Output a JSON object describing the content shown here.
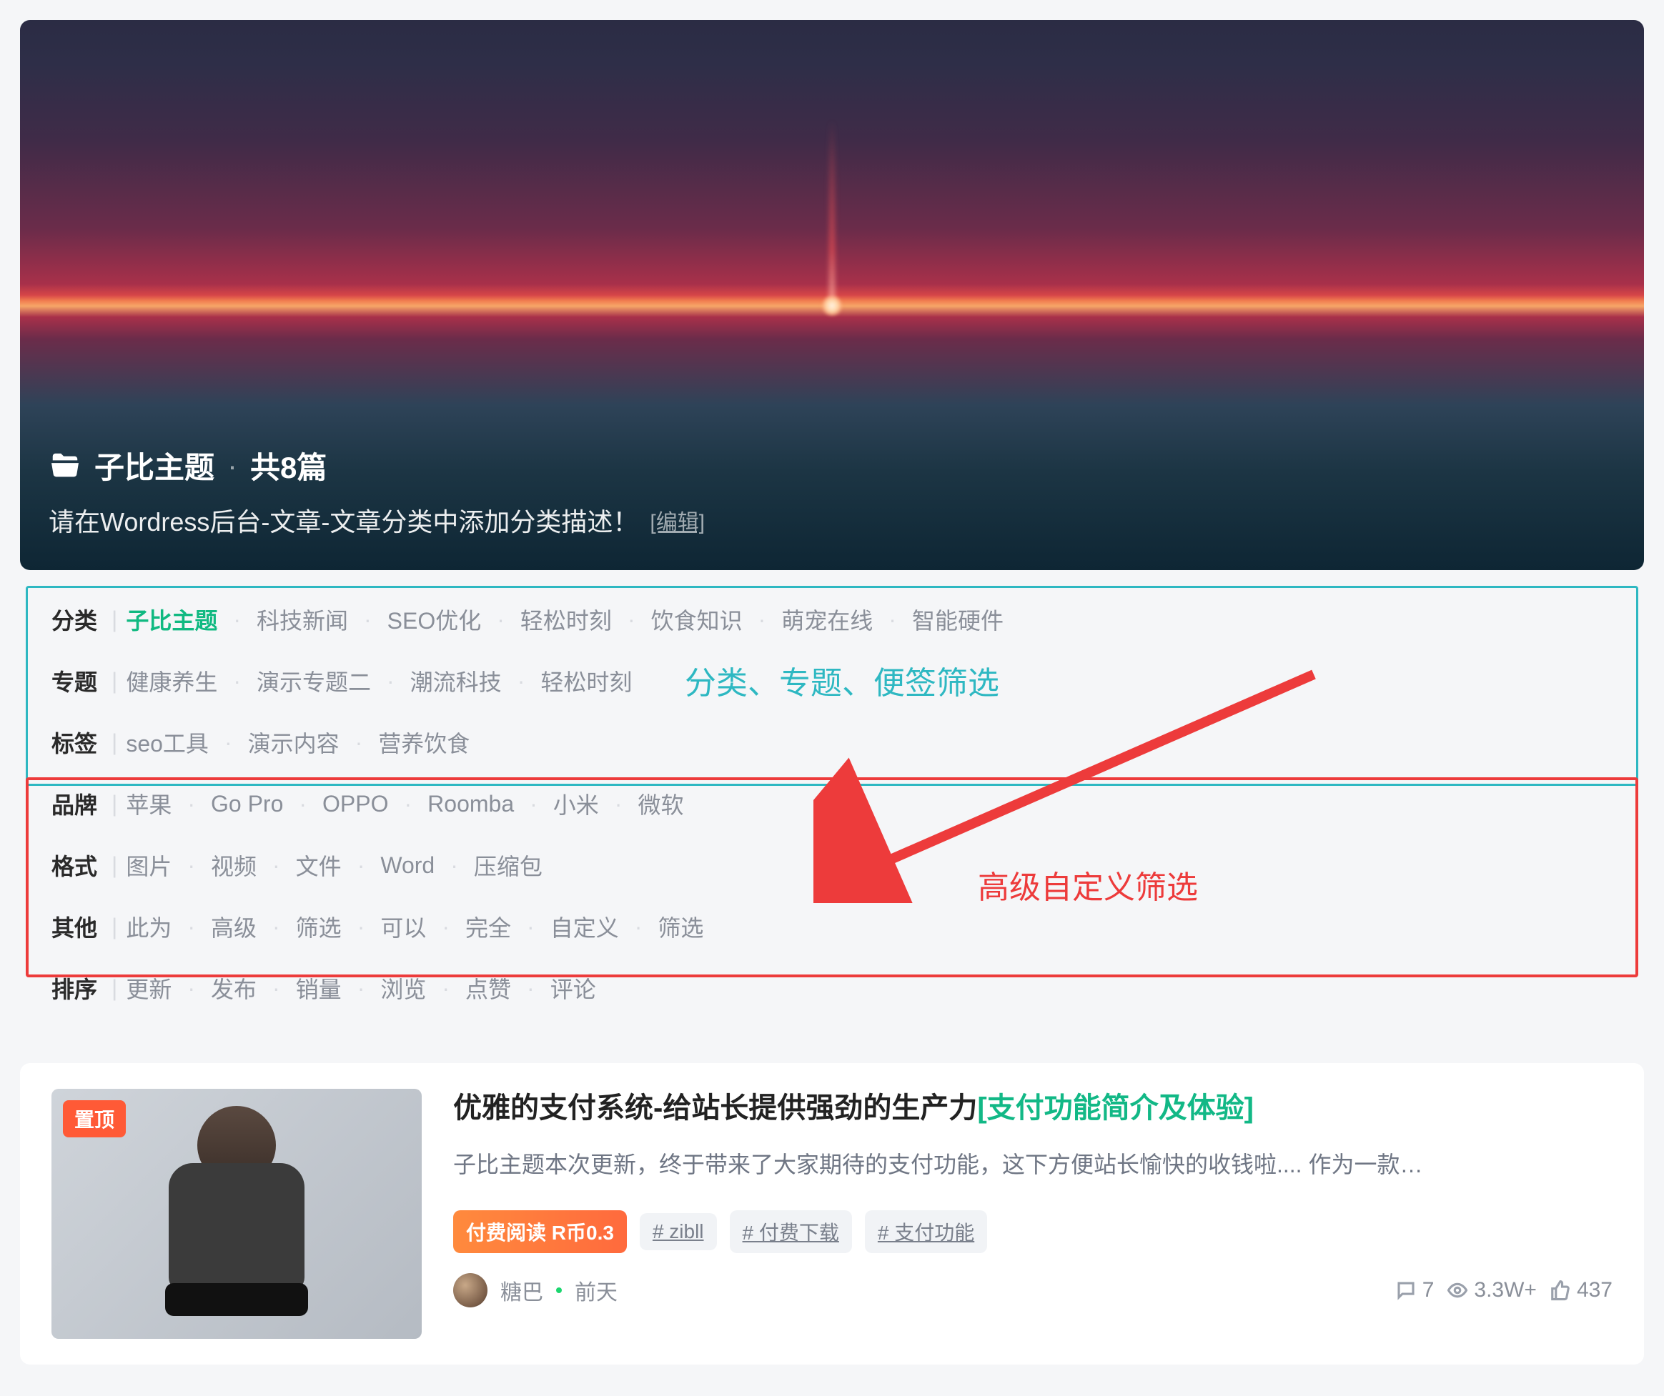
{
  "banner": {
    "category_label": "子比主题",
    "count_label": "共8篇",
    "description": "请在Wordress后台-文章-文章分类中添加分类描述！",
    "edit_label": "[编辑]"
  },
  "filters": {
    "rows": [
      {
        "label": "分类",
        "active_index": 0,
        "options": [
          "子比主题",
          "科技新闻",
          "SEO优化",
          "轻松时刻",
          "饮食知识",
          "萌宠在线",
          "智能硬件"
        ]
      },
      {
        "label": "专题",
        "active_index": -1,
        "options": [
          "健康养生",
          "演示专题二",
          "潮流科技",
          "轻松时刻"
        ]
      },
      {
        "label": "标签",
        "active_index": -1,
        "options": [
          "seo工具",
          "演示内容",
          "营养饮食"
        ]
      },
      {
        "label": "品牌",
        "active_index": -1,
        "options": [
          "苹果",
          "Go Pro",
          "OPPO",
          "Roomba",
          "小米",
          "微软"
        ]
      },
      {
        "label": "格式",
        "active_index": -1,
        "options": [
          "图片",
          "视频",
          "文件",
          "Word",
          "压缩包"
        ]
      },
      {
        "label": "其他",
        "active_index": -1,
        "options": [
          "此为",
          "高级",
          "筛选",
          "可以",
          "完全",
          "自定义",
          "筛选"
        ]
      },
      {
        "label": "排序",
        "active_index": -1,
        "options": [
          "更新",
          "发布",
          "销量",
          "浏览",
          "点赞",
          "评论"
        ]
      }
    ],
    "annotation_top": "分类、专题、便签筛选",
    "annotation_mid": "高级自定义筛选"
  },
  "article": {
    "pin_label": "置顶",
    "title_prefix": "优雅的支付系统-给站长提供强劲的生产力",
    "title_highlight": "[支付功能简介及体验]",
    "excerpt": "子比主题本次更新，终于带来了大家期待的支付功能，这下方便站长愉快的收钱啦.... 作为一款…",
    "price_badge": "付费阅读 R币0.3",
    "tags": [
      "# zibll",
      "# 付费下载",
      "# 支付功能"
    ],
    "author": "糖巴",
    "date": "前天",
    "stats": {
      "comments": "7",
      "views": "3.3W+",
      "likes": "437"
    }
  }
}
